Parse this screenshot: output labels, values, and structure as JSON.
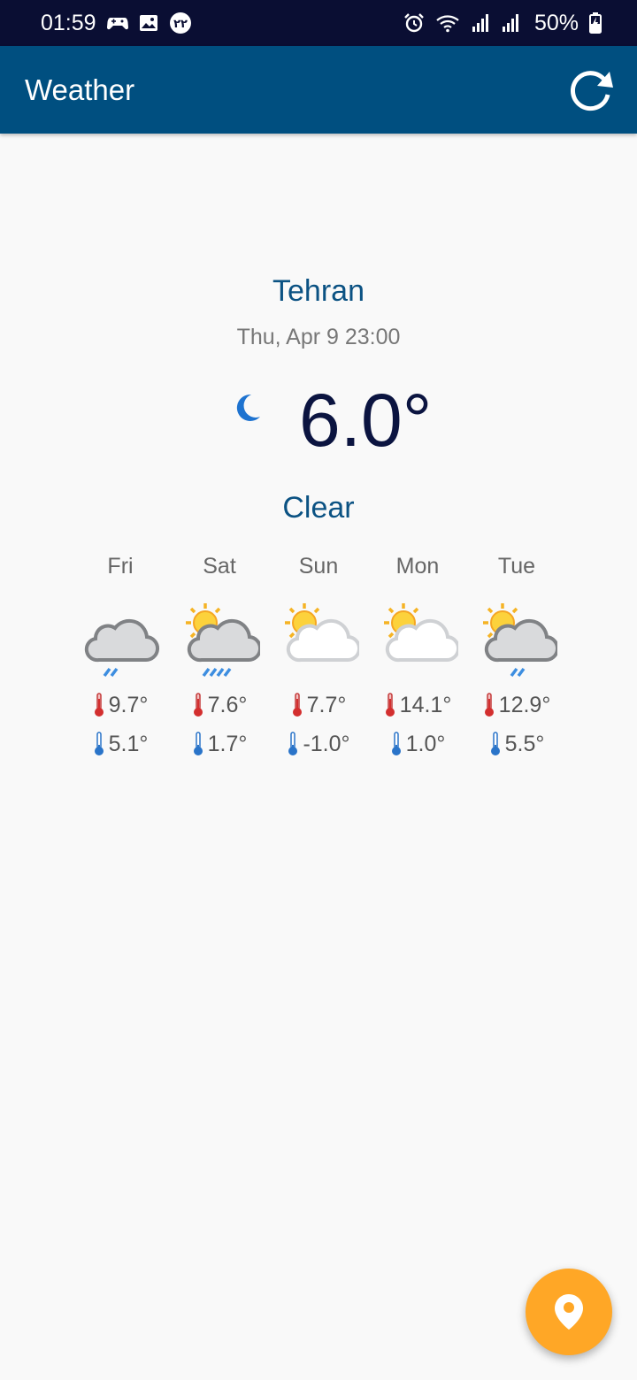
{
  "status_bar": {
    "time": "01:59",
    "notification_badge": "۲۲",
    "battery_percent": "50%",
    "icons": [
      "gamepad-icon",
      "gallery-icon",
      "badge-icon",
      "alarm-icon",
      "wifi-icon",
      "signal-icon",
      "signal-icon-2",
      "battery-icon"
    ]
  },
  "app_bar": {
    "title": "Weather",
    "refresh_icon": "refresh-icon"
  },
  "current": {
    "city": "Tehran",
    "datetime": "Thu, Apr 9 23:00",
    "temperature": "6.0°",
    "condition": "Clear",
    "icon": "moon-icon"
  },
  "forecast": [
    {
      "day": "Fri",
      "icon": "cloud-rain-icon",
      "high": "9.7°",
      "low": "5.1°"
    },
    {
      "day": "Sat",
      "icon": "sun-cloud-heavy-rain-icon",
      "high": "7.6°",
      "low": "1.7°"
    },
    {
      "day": "Sun",
      "icon": "sun-cloud-icon",
      "high": "7.7°",
      "low": "-1.0°"
    },
    {
      "day": "Mon",
      "icon": "sun-cloud-icon",
      "high": "14.1°",
      "low": "1.0°"
    },
    {
      "day": "Tue",
      "icon": "sun-cloud-rain-icon",
      "high": "12.9°",
      "low": "5.5°"
    }
  ],
  "fab": {
    "icon": "location-pin-icon"
  },
  "colors": {
    "status_bar": "#0a0e33",
    "app_bar": "#004f80",
    "accent_text": "#0b5283",
    "fab": "#ffa726"
  }
}
